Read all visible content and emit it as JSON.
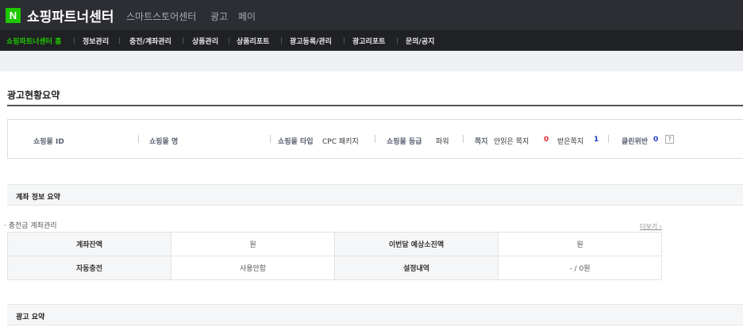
{
  "header": {
    "logo_letter": "N",
    "brand": "쇼핑파트너센터",
    "nav": [
      "스마트스토어센터",
      "광고",
      "페이"
    ]
  },
  "subnav": {
    "items": [
      "쇼핑파트너센터 홈",
      "정보관리",
      "충전/계좌관리",
      "상품관리",
      "상품리포트",
      "광고등록/관리",
      "광고리포트",
      "문의/공지"
    ],
    "active_index": 0
  },
  "page_title": "광고현황요약",
  "summary": {
    "mall_id_label": "쇼핑몰 ID",
    "mall_name_label": "쇼핑몰 명",
    "mall_type_label": "쇼핑몰 타입",
    "mall_type_value": "CPC 패키지",
    "mall_grade_label": "쇼핑몰 등급",
    "mall_grade_value": "파워",
    "memo_label": "쪽지",
    "unread_label": "안읽은 쪽지",
    "unread_count": "0",
    "received_label": "받은쪽지",
    "received_count": "1",
    "violation_label": "클린위반",
    "violation_count": "0",
    "help_mark": "?"
  },
  "account_section": {
    "title": "계좌 정보 요약",
    "subtitle": "· 충전금 계좌관리",
    "more_link": "더보기 ›",
    "rows": [
      {
        "label1": "계좌잔액",
        "value1": "원",
        "label2": "이번달 예상소진액",
        "value2": "원"
      },
      {
        "label1": "자동충전",
        "value1": "사용안함",
        "label2": "설정내역",
        "value2": "- / 0원"
      }
    ]
  },
  "ad_section": {
    "title": "광고 요약"
  },
  "colors": {
    "header_bg": "#2c2e33",
    "subnav_bg": "#202124",
    "accent_green": "#1ec800",
    "count_red": "#e5262c",
    "count_blue": "#1e38c8"
  }
}
